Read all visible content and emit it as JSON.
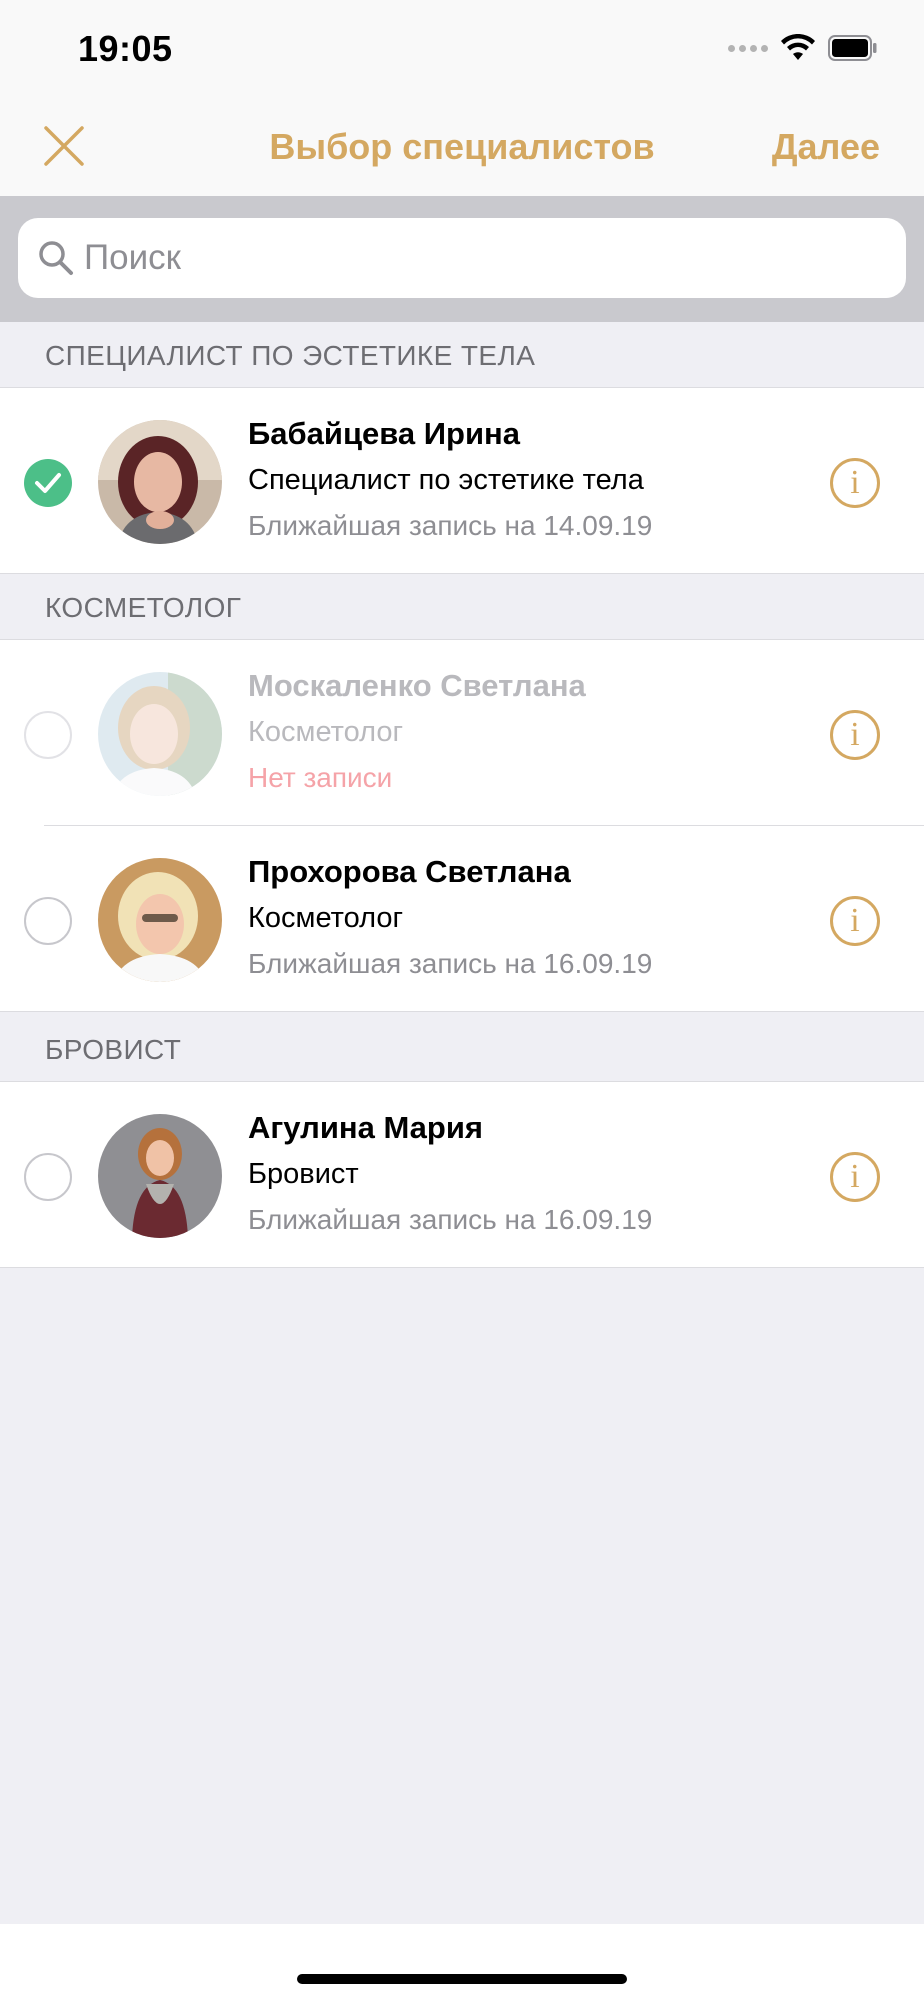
{
  "status_bar": {
    "time": "19:05"
  },
  "nav": {
    "title": "Выбор специалистов",
    "next_label": "Далее",
    "accent_color": "#d4a861"
  },
  "search": {
    "placeholder": "Поиск",
    "value": ""
  },
  "sections": [
    {
      "header": "СПЕЦИАЛИСТ ПО ЭСТЕТИКЕ ТЕЛА",
      "items": [
        {
          "name": "Бабайцева Ирина",
          "role": "Специалист по эстетике тела",
          "next_slot": "Ближайшая запись на 14.09.19",
          "selected": true,
          "available": true
        }
      ]
    },
    {
      "header": "КОСМЕТОЛОГ",
      "items": [
        {
          "name": "Москаленко Светлана",
          "role": "Косметолог",
          "next_slot": "Нет записи",
          "selected": false,
          "available": false
        },
        {
          "name": "Прохорова Светлана",
          "role": "Косметолог",
          "next_slot": "Ближайшая запись на 16.09.19",
          "selected": false,
          "available": true
        }
      ]
    },
    {
      "header": "БРОВИСТ",
      "items": [
        {
          "name": "Агулина Мария",
          "role": "Бровист",
          "next_slot": "Ближайшая запись на 16.09.19",
          "selected": false,
          "available": true
        }
      ]
    }
  ],
  "info_glyph": "i",
  "colors": {
    "selected_check": "#4cbf88",
    "no_slot": "#f5a3a8"
  }
}
